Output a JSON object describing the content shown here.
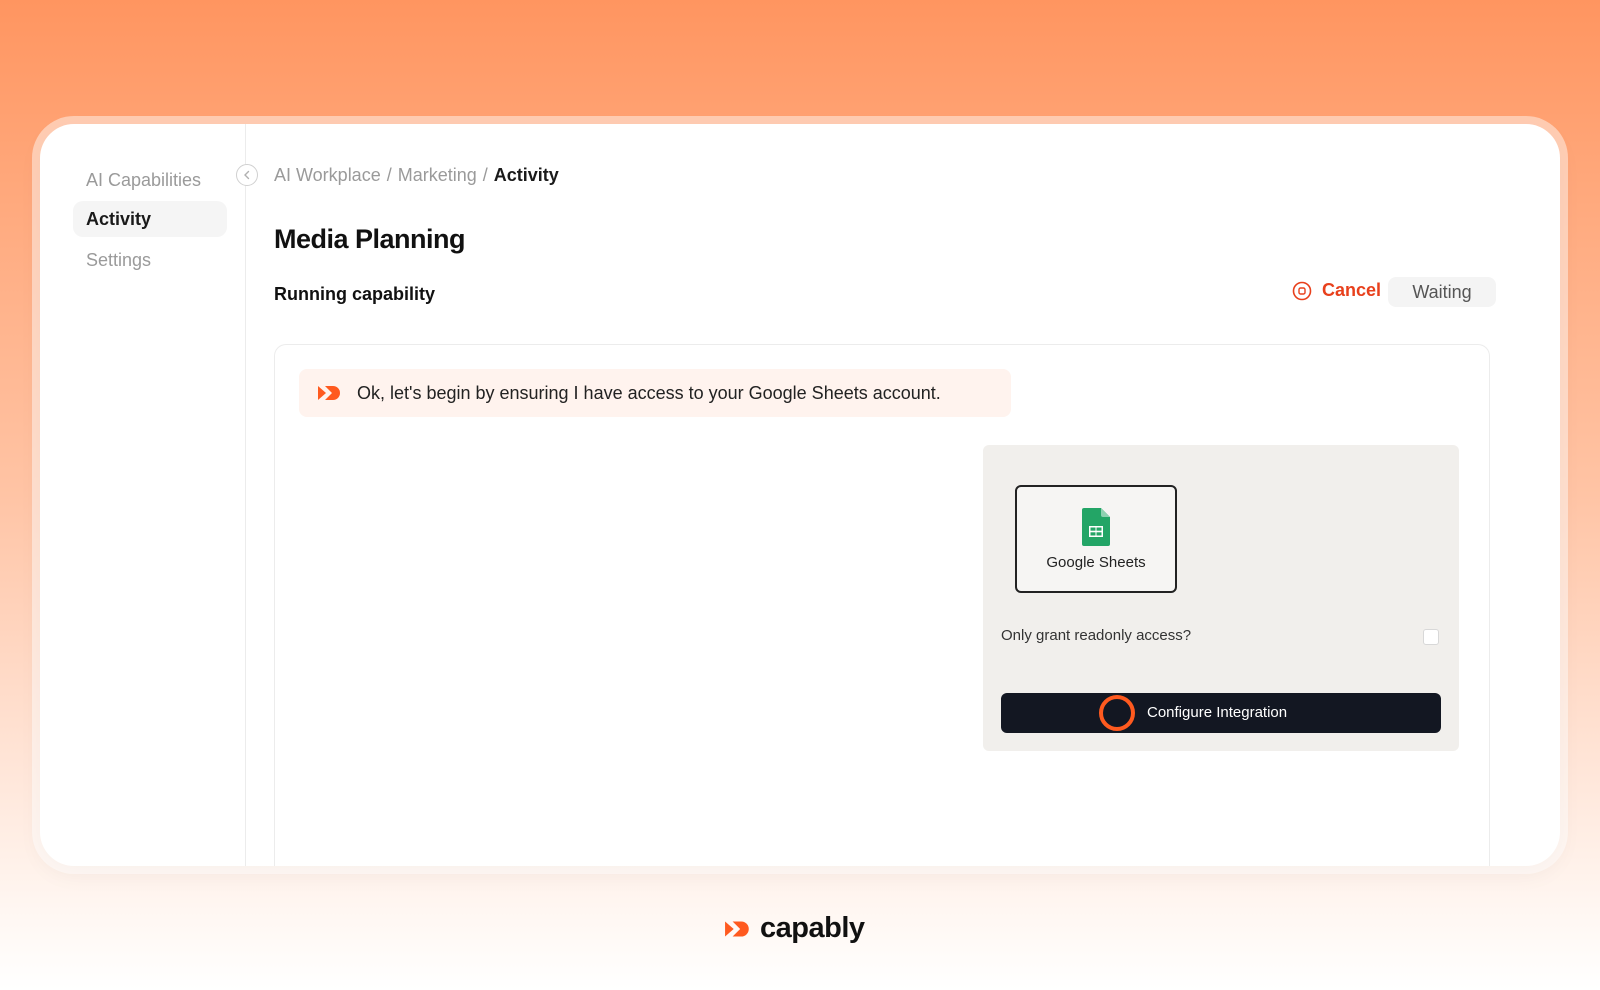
{
  "sidebar": {
    "items": [
      {
        "label": "AI Capabilities",
        "active": false
      },
      {
        "label": "Activity",
        "active": true
      },
      {
        "label": "Settings",
        "active": false
      }
    ]
  },
  "breadcrumb": {
    "items": [
      "AI Workplace",
      "Marketing",
      "Activity"
    ],
    "separator": "/"
  },
  "page": {
    "title": "Media Planning",
    "section_title": "Running capability",
    "cancel_label": "Cancel",
    "status": "Waiting"
  },
  "message": {
    "icon": "capably-logo-icon",
    "text": "Ok, let's begin by ensuring I have access to your Google Sheets account."
  },
  "integration": {
    "app_name": "Google Sheets",
    "app_icon": "google-sheets-icon",
    "readonly_label": "Only grant readonly access?",
    "readonly_checked": false,
    "configure_label": "Configure Integration"
  },
  "footer": {
    "brand": "capably"
  },
  "colors": {
    "accent": "#e8401c",
    "logo_orange": "#ff5a1f",
    "dark_button": "#131722",
    "sheets_green": "#23a566"
  }
}
